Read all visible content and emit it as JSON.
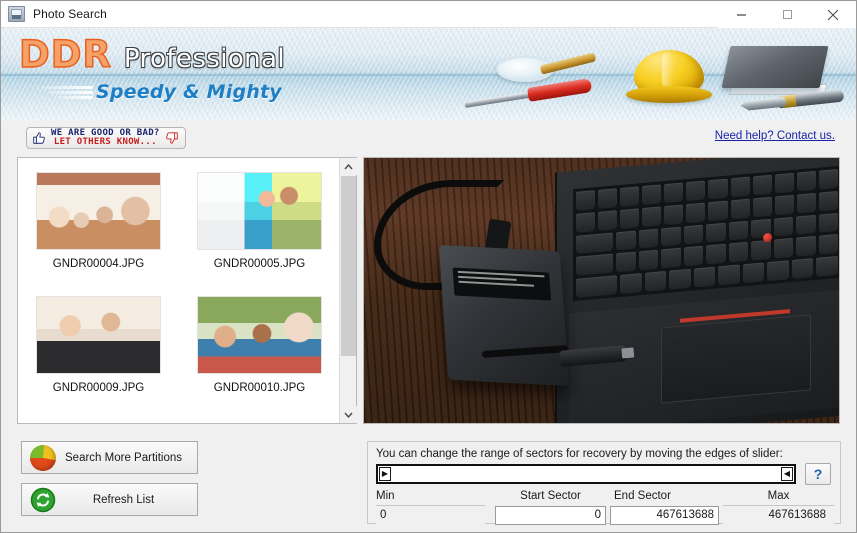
{
  "window": {
    "title": "Photo Search",
    "icon": "app-icon",
    "controls": {
      "minimize": "minimize-button",
      "maximize": "maximize-button",
      "close": "close-button"
    }
  },
  "banner": {
    "logo_main": "DDR",
    "logo_sub": "Professional",
    "tagline": "Speedy & Mighty",
    "colors": {
      "logo_orange": "#e8601d",
      "tagline_blue": "#1f7fc4",
      "banner_blue": "#aacfe0"
    },
    "illustrations": [
      "magnifier-icon",
      "screwdriver-icon",
      "hard-hat-icon",
      "book-icon",
      "pen-icon"
    ]
  },
  "feedback": {
    "line1": "WE ARE GOOD OR BAD?",
    "line2": "LET OTHERS KNOW...",
    "thumb_up_icon": "thumbs-up-icon",
    "thumb_down_icon": "thumbs-down-icon",
    "line1_color": "#19246b",
    "line2_color": "#c81c1c"
  },
  "help": {
    "link_text": "Need help? Contact us.",
    "link_color": "#1a24a8"
  },
  "thumbnails": {
    "items": [
      {
        "label": "GNDR00004.JPG",
        "photo": "group-of-friends-at-cafe"
      },
      {
        "label": "GNDR00005.JPG",
        "photo": "couple-on-couch-with-laptop"
      },
      {
        "label": "GNDR00009.JPG",
        "photo": "two-men-outdoors"
      },
      {
        "label": "GNDR00010.JPG",
        "photo": "three-women-laughing"
      }
    ],
    "scrollbar": {
      "up_arrow": "scroll-up-arrow",
      "down_arrow": "scroll-down-arrow"
    }
  },
  "preview": {
    "description": "external-hard-drive-connected-to-laptop-on-wooden-desk"
  },
  "actions": {
    "search_more_partitions": "Search More Partitions",
    "refresh_list": "Refresh List",
    "partition_icon": "pie-chart-icon",
    "refresh_icon": "refresh-icon"
  },
  "sector": {
    "hint": "You can change the range of sectors for recovery by moving the edges of slider:",
    "help_button": "?",
    "left_handle_glyph": "▶",
    "right_handle_glyph": "◀",
    "fields": {
      "min_label": "Min",
      "min_value": "0",
      "start_label": "Start Sector",
      "start_value": "0",
      "end_label": "End Sector",
      "end_value": "467613688",
      "max_label": "Max",
      "max_value": "467613688"
    }
  }
}
